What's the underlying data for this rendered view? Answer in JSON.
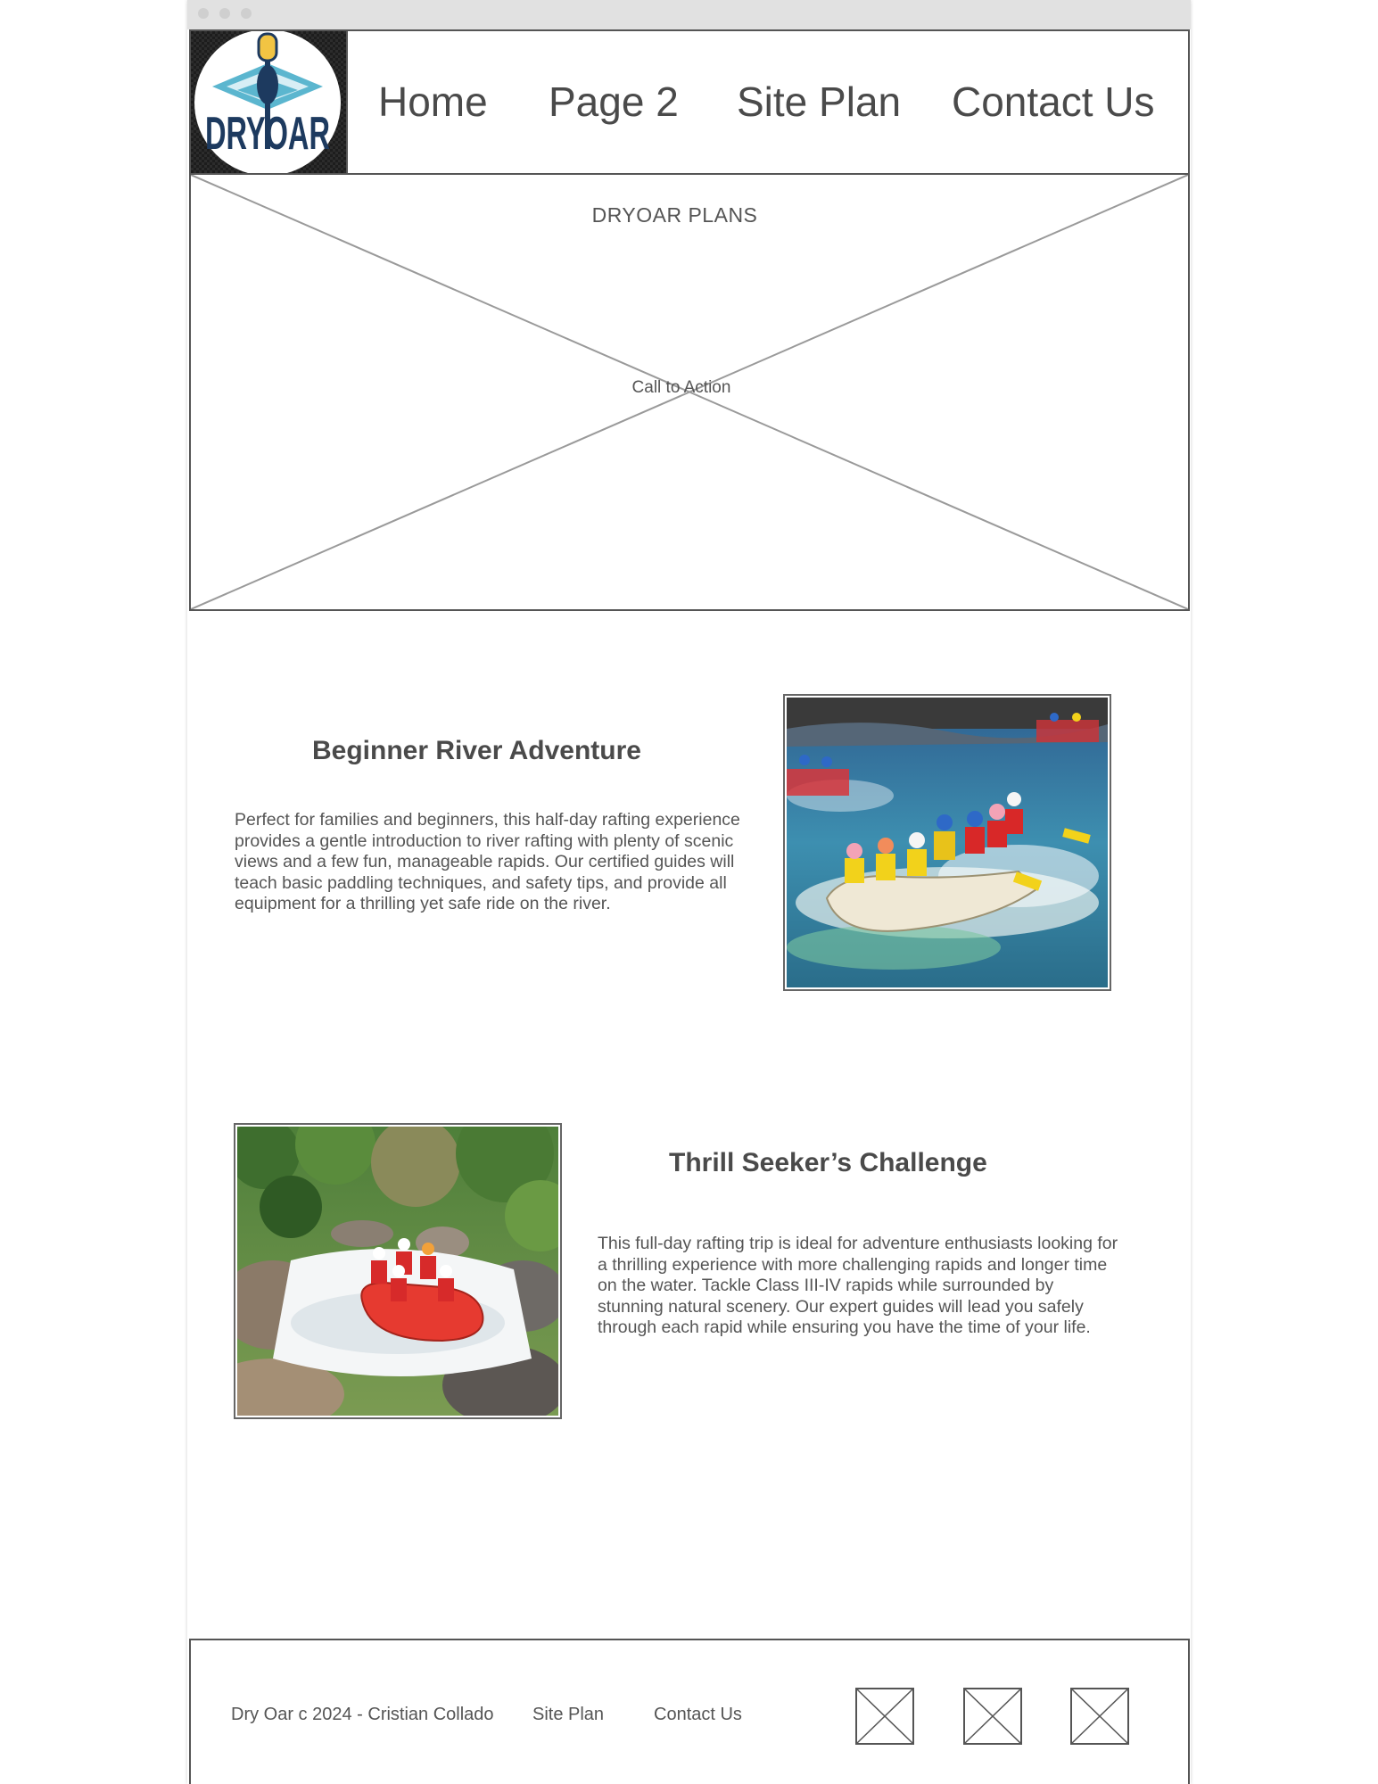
{
  "logo": {
    "text": "DRYOAR"
  },
  "nav": {
    "items": [
      {
        "label": "Home"
      },
      {
        "label": "Page 2"
      },
      {
        "label": "Site Plan"
      },
      {
        "label": "Contact Us"
      }
    ]
  },
  "hero": {
    "title": "DRYOAR PLANS",
    "cta_label": "Call to Action"
  },
  "sections": [
    {
      "title": "Beginner River Adventure",
      "body": "Perfect for families and beginners, this half-day rafting experience provides a gentle introduction to river rafting with plenty of scenic views and a few fun, manageable rapids. Our certified guides will teach basic paddling techniques, and safety tips, and provide all equipment for a thrilling yet safe ride on the river."
    },
    {
      "title": "Thrill Seeker’s Challenge",
      "body": "This full-day rafting trip is ideal for adventure enthusiasts looking for a thrilling experience with more challenging rapids and longer time on the water. Tackle Class III-IV rapids while surrounded by stunning natural scenery. Our expert guides will lead you safely through each rapid while ensuring you have the time of your life."
    }
  ],
  "footer": {
    "copyright": "Dry Oar c 2024 - Cristian Collado",
    "links": [
      {
        "label": "Site Plan"
      },
      {
        "label": "Contact Us"
      }
    ],
    "social_icons": [
      "image-placeholder-icon",
      "image-placeholder-icon",
      "image-placeholder-icon"
    ]
  },
  "colors": {
    "border": "#555555",
    "text": "#444444",
    "logo_navy": "#1d3a5f",
    "logo_teal": "#5bb6cf",
    "logo_yellow": "#f2c443"
  }
}
